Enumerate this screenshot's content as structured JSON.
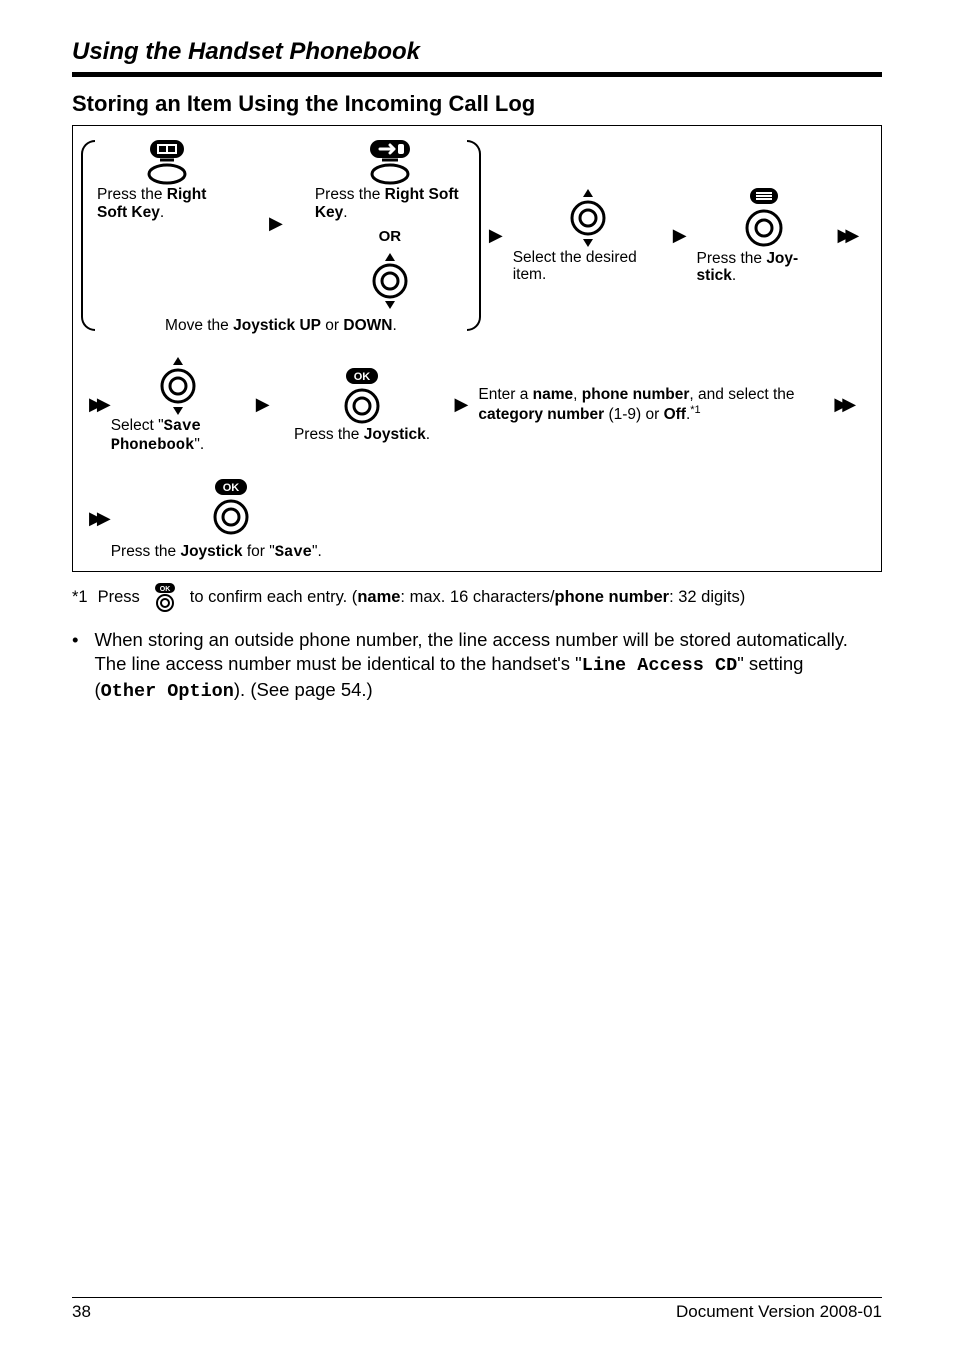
{
  "header": {
    "section": "Using the Handset Phonebook"
  },
  "subtitle": "Storing an Item Using the Incoming Call Log",
  "steps": {
    "pressRightSoftKey1_a": "Press the ",
    "pressRightSoftKey1_b": "Right Soft Key",
    "pressRightSoftKey1_c": ".",
    "orLabel": "OR",
    "moveJoystick_a": "Move the ",
    "moveJoystick_b": "Joystick UP",
    "moveJoystick_c": " or ",
    "moveJoystick_d": "DOWN",
    "moveJoystick_e": ".",
    "pressRightSoftKey2_a": "Press the ",
    "pressRightSoftKey2_b": "Right Soft Key",
    "pressRightSoftKey2_c": ".",
    "selectItem": "Select the desired item.",
    "pressJoystick_a": "Press the ",
    "pressJoystick_b": "Joy-stick",
    "pressJoystick_c": ".",
    "selectSave_a": "Select \"",
    "selectSave_b_mono": "Save Phonebook",
    "selectSave_c": "\".",
    "pressJoystick2_a": "Press the ",
    "pressJoystick2_b": "Joystick",
    "pressJoystick2_c": ".",
    "enterDesc_a": "Enter a ",
    "enterDesc_b": "name",
    "enterDesc_c": ", ",
    "enterDesc_d": "phone number",
    "enterDesc_e": ", and select the ",
    "enterDesc_f": "category number",
    "enterDesc_g": " (1-9) or ",
    "enterDesc_h": "Off",
    "enterDesc_i": ".",
    "enterDesc_sup": "*1",
    "pressJoystickSave_a": "Press the ",
    "pressJoystickSave_b": "Joystick",
    "pressJoystickSave_c": " for \"",
    "pressJoystickSave_d_mono": "Save",
    "pressJoystickSave_e": "\"."
  },
  "footnote": {
    "marker": "*1",
    "text_a": "Press ",
    "text_b": " to confirm each entry. (",
    "text_c": "name",
    "text_d": ": max. 16 characters/",
    "text_e": "phone number",
    "text_f": ": 32 digits)"
  },
  "bullet": {
    "text_a": "When storing an outside phone number, the line access number will be stored automatically. The line access number must be identical to the handset's \"",
    "text_b_mono": "Line Access CD",
    "text_c": "\" setting (",
    "text_d_mono": "Other Option",
    "text_e": "). (See page 54.)"
  },
  "footer": {
    "page": "38",
    "docver": "Document Version 2008-01"
  },
  "icons": {
    "ok_label": "OK"
  }
}
